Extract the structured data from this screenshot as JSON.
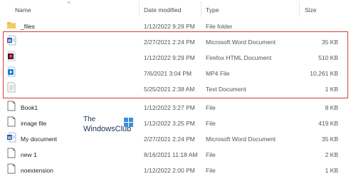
{
  "columns": {
    "name": "Name",
    "date_modified": "Date modified",
    "type": "Type",
    "size": "Size"
  },
  "rows": [
    {
      "name": "_files",
      "date": "1/12/2022 9:29 PM",
      "type": "File folder",
      "size": "",
      "icon": "folder-icon"
    },
    {
      "name": "",
      "date": "2/27/2021 2:24 PM",
      "type": "Microsoft Word Document",
      "size": "35 KB",
      "icon": "word-document-icon"
    },
    {
      "name": "",
      "date": "1/12/2022 9:29 PM",
      "type": "Firefox HTML Document",
      "size": "510 KB",
      "icon": "firefox-html-icon"
    },
    {
      "name": "",
      "date": "7/6/2021 3:04 PM",
      "type": "MP4 File",
      "size": "10,261 KB",
      "icon": "mp4-video-icon"
    },
    {
      "name": "",
      "date": "5/25/2021 2:38 AM",
      "type": "Text Document",
      "size": "1 KB",
      "icon": "text-document-icon"
    },
    {
      "name": "Book1",
      "date": "1/12/2022 3:27 PM",
      "type": "File",
      "size": "8 KB",
      "icon": "generic-file-icon"
    },
    {
      "name": "image file",
      "date": "1/12/2022 3:25 PM",
      "type": "File",
      "size": "419 KB",
      "icon": "generic-file-icon"
    },
    {
      "name": "My document",
      "date": "2/27/2021 2:24 PM",
      "type": "Microsoft Word Document",
      "size": "35 KB",
      "icon": "word-document-icon"
    },
    {
      "name": "new 1",
      "date": "8/16/2021 11:18 AM",
      "type": "File",
      "size": "2 KB",
      "icon": "generic-file-icon"
    },
    {
      "name": "noextension",
      "date": "1/12/2022 2:00 PM",
      "type": "File",
      "size": "1 KB",
      "icon": "generic-file-icon"
    }
  ],
  "watermark": {
    "line1": "The",
    "line2": "WindowsClub"
  },
  "colors": {
    "highlight": "#d83c3c",
    "folder": "#e8b53d",
    "word": "#2b579a",
    "firefox": "#b5172b",
    "mp4": "#1e7fd1"
  }
}
